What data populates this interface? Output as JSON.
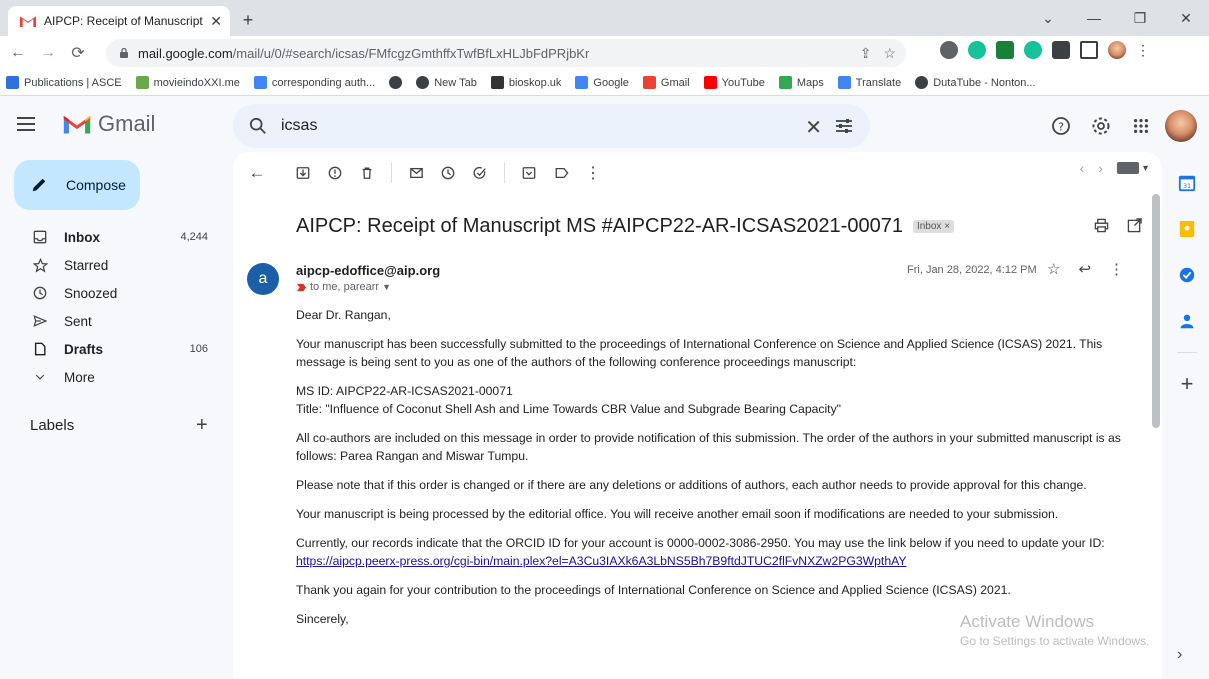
{
  "browser": {
    "tab_title": "AIPCP: Receipt of Manuscript MS",
    "url_host": "mail.google.com",
    "url_path": "/mail/u/0/#search/icsas/FMfcgzGmthffxTwfBfLxHLJbFdPRjbKr",
    "bookmarks": [
      {
        "label": "Publications | ASCE",
        "color": "#2f6fde"
      },
      {
        "label": "movieindoXXI.me",
        "color": "#6aa84f"
      },
      {
        "label": "corresponding auth...",
        "color": "#4285f4"
      },
      {
        "label": "",
        "color": "#3c4043"
      },
      {
        "label": "New Tab",
        "color": "#3c4043"
      },
      {
        "label": "bioskop.uk",
        "color": "#333333"
      },
      {
        "label": "Google",
        "color": "#4285f4"
      },
      {
        "label": "Gmail",
        "color": "#ea4335"
      },
      {
        "label": "YouTube",
        "color": "#ff0000"
      },
      {
        "label": "Maps",
        "color": "#34a853"
      },
      {
        "label": "Translate",
        "color": "#4285f4"
      },
      {
        "label": "DutaTube - Nonton...",
        "color": "#3c4043"
      }
    ]
  },
  "gmail": {
    "logo_text": "Gmail",
    "search_value": "icsas",
    "compose_label": "Compose",
    "nav": [
      {
        "label": "Inbox",
        "count": "4,244",
        "bold": true,
        "icon": "inbox-icon"
      },
      {
        "label": "Starred",
        "count": "",
        "bold": false,
        "icon": "star-icon"
      },
      {
        "label": "Snoozed",
        "count": "",
        "bold": false,
        "icon": "clock-icon"
      },
      {
        "label": "Sent",
        "count": "",
        "bold": false,
        "icon": "send-icon"
      },
      {
        "label": "Drafts",
        "count": "106",
        "bold": true,
        "icon": "draft-icon"
      },
      {
        "label": "More",
        "count": "",
        "bold": false,
        "icon": "chevron-down-icon"
      }
    ],
    "labels_title": "Labels"
  },
  "email": {
    "subject": "AIPCP: Receipt of Manuscript MS #AIPCP22-AR-ICSAS2021-00071",
    "label_chip": "Inbox ×",
    "avatar_letter": "a",
    "sender": "aipcp-edoffice@aip.org",
    "to": "to me, parearr",
    "date": "Fri, Jan 28, 2022, 4:12 PM",
    "body": {
      "greeting": "Dear Dr. Rangan,",
      "p1": "Your manuscript has been successfully submitted to the proceedings of International Conference on Science and Applied Science (ICSAS) 2021. This message is being sent to you as one of the authors of the following conference proceedings manuscript:",
      "ms_id": "MS ID: AIPCP22-AR-ICSAS2021-00071",
      "title": "Title: \"Influence of Coconut Shell Ash and Lime Towards CBR Value and Subgrade Bearing Capacity\"",
      "p2": "All co-authors are included on this message in order to provide notification of this submission. The order of the authors in your submitted manuscript is as follows: Parea Rangan and Miswar Tumpu.",
      "p3": "Please note that if this order is changed or if there are any deletions or additions of authors, each author needs to provide approval for this change.",
      "p4": "Your manuscript is being processed by the editorial office. You will receive another email soon if modifications are needed to your submission.",
      "p5": "Currently, our records indicate that the ORCID ID for your account is 0000-0002-3086-2950. You may use the link below if you need to update your ID:",
      "link": "https://aipcp.peerx-press.org/cgi-bin/main.plex?el=A3Cu3IAXk6A3LbNS5Bh7B9ftdJTUC2flFvNXZw2PG3WpthAY",
      "p6": "Thank you again for your contribution to the proceedings of International Conference on Science and Applied Science (ICSAS) 2021.",
      "closing": "Sincerely,"
    }
  },
  "watermark": {
    "line1": "Activate Windows",
    "line2": "Go to Settings to activate Windows."
  },
  "colors": {
    "compose_bg": "#c2e7ff",
    "search_bg": "#eaf1fb",
    "avatar_bg": "#1a5fa8",
    "link": "#1a0dab"
  }
}
